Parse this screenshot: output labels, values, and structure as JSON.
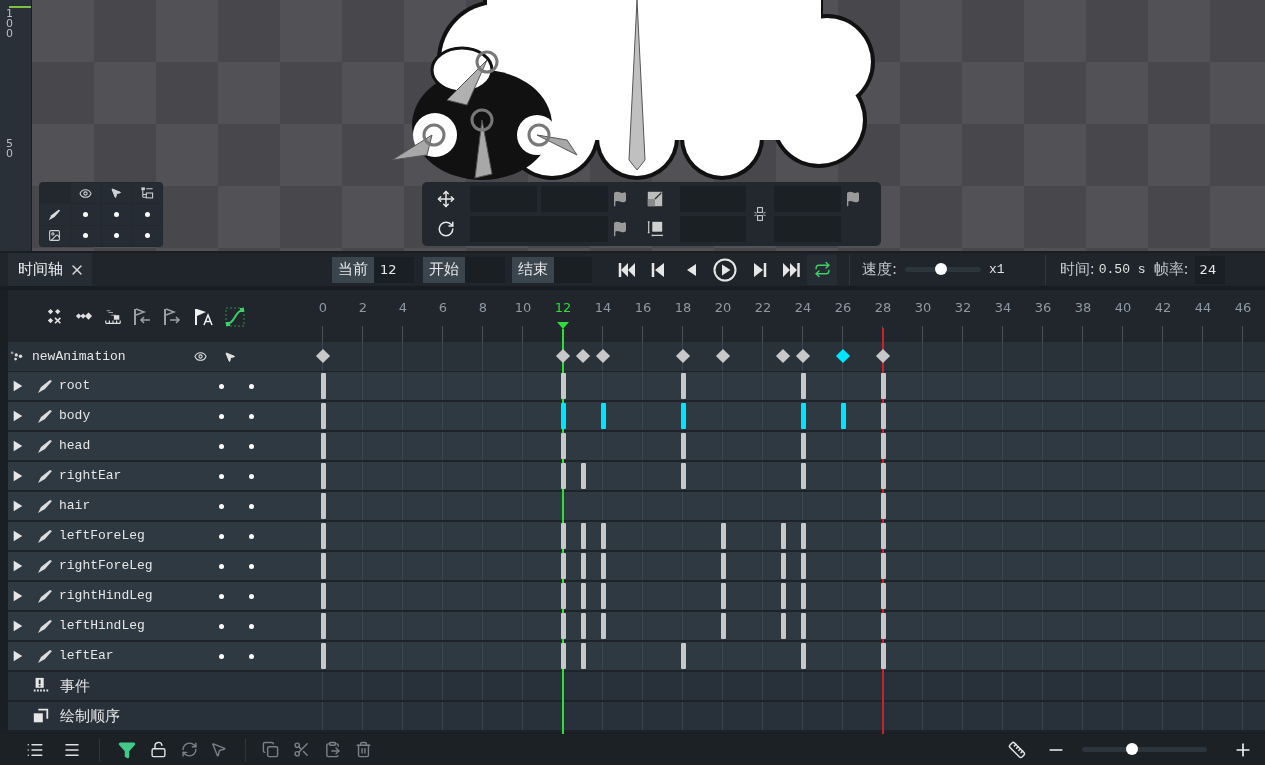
{
  "viewport": {
    "ruler_labels": [
      "100",
      "50"
    ]
  },
  "timeline": {
    "tab": {
      "label": "时间轴",
      "selected": true
    },
    "current": {
      "label": "当前",
      "value": "12"
    },
    "start": {
      "label": "开始"
    },
    "end": {
      "label": "结束"
    },
    "loop": {
      "on": true
    },
    "speed": {
      "label": "速度:",
      "level": 0.47,
      "reading": "x1"
    },
    "time": {
      "label": "时间:",
      "value": "0.50 s"
    },
    "fps": {
      "label": "帧率:",
      "value": "24"
    },
    "graph": {
      "on": true
    },
    "ticks": [
      {
        "label": "0",
        "kind": "normal"
      },
      {
        "label": "2",
        "kind": "normal"
      },
      {
        "label": "4",
        "kind": "normal"
      },
      {
        "label": "6",
        "kind": "normal"
      },
      {
        "label": "8",
        "kind": "normal"
      },
      {
        "label": "10",
        "kind": "normal"
      },
      {
        "label": "12",
        "kind": "current"
      },
      {
        "label": "14",
        "kind": "normal"
      },
      {
        "label": "16",
        "kind": "normal"
      },
      {
        "label": "18",
        "kind": "normal"
      },
      {
        "label": "20",
        "kind": "normal"
      },
      {
        "label": "22",
        "kind": "normal"
      },
      {
        "label": "24",
        "kind": "normal"
      },
      {
        "label": "26",
        "kind": "normal"
      },
      {
        "label": "28",
        "kind": "end"
      },
      {
        "label": "30",
        "kind": "normal"
      },
      {
        "label": "32",
        "kind": "normal"
      },
      {
        "label": "34",
        "kind": "normal"
      },
      {
        "label": "36",
        "kind": "normal"
      },
      {
        "label": "38",
        "kind": "normal"
      },
      {
        "label": "40",
        "kind": "normal"
      },
      {
        "label": "42",
        "kind": "normal"
      },
      {
        "label": "44",
        "kind": "normal"
      },
      {
        "label": "46",
        "kind": "normal"
      }
    ],
    "animation": {
      "name": "newAnimation",
      "frames": [
        {
          "key": true,
          "color": "#c8c8c8"
        },
        {
          "key": false
        },
        {
          "key": false
        },
        {
          "key": false
        },
        {
          "key": false
        },
        {
          "key": false
        },
        {
          "key": false
        },
        {
          "key": false
        },
        {
          "key": false
        },
        {
          "key": false
        },
        {
          "key": false
        },
        {
          "key": false
        },
        {
          "key": true,
          "color": "#c8c8c8"
        },
        {
          "key": true,
          "color": "#c8c8c8"
        },
        {
          "key": true,
          "color": "#c8c8c8"
        },
        {
          "key": false
        },
        {
          "key": false
        },
        {
          "key": false
        },
        {
          "key": true,
          "color": "#c8c8c8"
        },
        {
          "key": false
        },
        {
          "key": true,
          "color": "#c8c8c8"
        },
        {
          "key": false
        },
        {
          "key": false
        },
        {
          "key": true,
          "color": "#c8c8c8"
        },
        {
          "key": true,
          "color": "#c8c8c8"
        },
        {
          "key": false
        },
        {
          "key": true,
          "color": "#00e5ff"
        },
        {
          "key": false
        },
        {
          "key": true,
          "color": "#c8c8c8"
        }
      ]
    },
    "bones": [
      {
        "name": "root",
        "expanded": false,
        "frames": [
          {
            "key": true,
            "color": "#c8c8c8"
          },
          {
            "key": false
          },
          {
            "key": false
          },
          {
            "key": false
          },
          {
            "key": false
          },
          {
            "key": false
          },
          {
            "key": false
          },
          {
            "key": false
          },
          {
            "key": false
          },
          {
            "key": false
          },
          {
            "key": false
          },
          {
            "key": false
          },
          {
            "key": true,
            "color": "#c8c8c8"
          },
          {
            "key": false
          },
          {
            "key": false
          },
          {
            "key": false
          },
          {
            "key": false
          },
          {
            "key": false
          },
          {
            "key": true,
            "color": "#c8c8c8"
          },
          {
            "key": false
          },
          {
            "key": false
          },
          {
            "key": false
          },
          {
            "key": false
          },
          {
            "key": false
          },
          {
            "key": true,
            "color": "#c8c8c8"
          },
          {
            "key": false
          },
          {
            "key": false
          },
          {
            "key": false
          },
          {
            "key": true,
            "color": "#c8c8c8"
          }
        ]
      },
      {
        "name": "body",
        "expanded": false,
        "frames": [
          {
            "key": true,
            "color": "#c8c8c8"
          },
          {
            "key": false
          },
          {
            "key": false
          },
          {
            "key": false
          },
          {
            "key": false
          },
          {
            "key": false
          },
          {
            "key": false
          },
          {
            "key": false
          },
          {
            "key": false
          },
          {
            "key": false
          },
          {
            "key": false
          },
          {
            "key": false
          },
          {
            "key": true,
            "color": "#00e5ff"
          },
          {
            "key": false
          },
          {
            "key": true,
            "color": "#00e5ff"
          },
          {
            "key": false
          },
          {
            "key": false
          },
          {
            "key": false
          },
          {
            "key": true,
            "color": "#00e5ff"
          },
          {
            "key": false
          },
          {
            "key": false
          },
          {
            "key": false
          },
          {
            "key": false
          },
          {
            "key": false
          },
          {
            "key": true,
            "color": "#00e5ff"
          },
          {
            "key": false
          },
          {
            "key": true,
            "color": "#00e5ff"
          },
          {
            "key": false
          },
          {
            "key": true,
            "color": "#c8c8c8"
          }
        ]
      },
      {
        "name": "head",
        "expanded": false,
        "frames": [
          {
            "key": true,
            "color": "#c8c8c8"
          },
          {
            "key": false
          },
          {
            "key": false
          },
          {
            "key": false
          },
          {
            "key": false
          },
          {
            "key": false
          },
          {
            "key": false
          },
          {
            "key": false
          },
          {
            "key": false
          },
          {
            "key": false
          },
          {
            "key": false
          },
          {
            "key": false
          },
          {
            "key": true,
            "color": "#c8c8c8"
          },
          {
            "key": false
          },
          {
            "key": false
          },
          {
            "key": false
          },
          {
            "key": false
          },
          {
            "key": false
          },
          {
            "key": true,
            "color": "#c8c8c8"
          },
          {
            "key": false
          },
          {
            "key": false
          },
          {
            "key": false
          },
          {
            "key": false
          },
          {
            "key": false
          },
          {
            "key": true,
            "color": "#c8c8c8"
          },
          {
            "key": false
          },
          {
            "key": false
          },
          {
            "key": false
          },
          {
            "key": true,
            "color": "#c8c8c8"
          }
        ]
      },
      {
        "name": "rightEar",
        "expanded": false,
        "frames": [
          {
            "key": true,
            "color": "#c8c8c8"
          },
          {
            "key": false
          },
          {
            "key": false
          },
          {
            "key": false
          },
          {
            "key": false
          },
          {
            "key": false
          },
          {
            "key": false
          },
          {
            "key": false
          },
          {
            "key": false
          },
          {
            "key": false
          },
          {
            "key": false
          },
          {
            "key": false
          },
          {
            "key": true,
            "color": "#c8c8c8"
          },
          {
            "key": true,
            "color": "#c8c8c8"
          },
          {
            "key": false
          },
          {
            "key": false
          },
          {
            "key": false
          },
          {
            "key": false
          },
          {
            "key": true,
            "color": "#c8c8c8"
          },
          {
            "key": false
          },
          {
            "key": false
          },
          {
            "key": false
          },
          {
            "key": false
          },
          {
            "key": false
          },
          {
            "key": true,
            "color": "#c8c8c8"
          },
          {
            "key": false
          },
          {
            "key": false
          },
          {
            "key": false
          },
          {
            "key": true,
            "color": "#c8c8c8"
          }
        ]
      },
      {
        "name": "hair",
        "expanded": false,
        "frames": [
          {
            "key": true,
            "color": "#c8c8c8"
          },
          {
            "key": false
          },
          {
            "key": false
          },
          {
            "key": false
          },
          {
            "key": false
          },
          {
            "key": false
          },
          {
            "key": false
          },
          {
            "key": false
          },
          {
            "key": false
          },
          {
            "key": false
          },
          {
            "key": false
          },
          {
            "key": false
          },
          {
            "key": false
          },
          {
            "key": false
          },
          {
            "key": false
          },
          {
            "key": false
          },
          {
            "key": false
          },
          {
            "key": false
          },
          {
            "key": false
          },
          {
            "key": false
          },
          {
            "key": false
          },
          {
            "key": false
          },
          {
            "key": false
          },
          {
            "key": false
          },
          {
            "key": false
          },
          {
            "key": false
          },
          {
            "key": false
          },
          {
            "key": false
          },
          {
            "key": true,
            "color": "#c8c8c8"
          }
        ]
      },
      {
        "name": "leftForeLeg",
        "expanded": false,
        "frames": [
          {
            "key": true,
            "color": "#c8c8c8"
          },
          {
            "key": false
          },
          {
            "key": false
          },
          {
            "key": false
          },
          {
            "key": false
          },
          {
            "key": false
          },
          {
            "key": false
          },
          {
            "key": false
          },
          {
            "key": false
          },
          {
            "key": false
          },
          {
            "key": false
          },
          {
            "key": false
          },
          {
            "key": true,
            "color": "#c8c8c8"
          },
          {
            "key": true,
            "color": "#c8c8c8"
          },
          {
            "key": true,
            "color": "#c8c8c8"
          },
          {
            "key": false
          },
          {
            "key": false
          },
          {
            "key": false
          },
          {
            "key": false
          },
          {
            "key": false
          },
          {
            "key": true,
            "color": "#c8c8c8"
          },
          {
            "key": false
          },
          {
            "key": false
          },
          {
            "key": true,
            "color": "#c8c8c8"
          },
          {
            "key": true,
            "color": "#c8c8c8"
          },
          {
            "key": false
          },
          {
            "key": false
          },
          {
            "key": false
          },
          {
            "key": true,
            "color": "#c8c8c8"
          }
        ]
      },
      {
        "name": "rightForeLeg",
        "expanded": false,
        "frames": [
          {
            "key": true,
            "color": "#c8c8c8"
          },
          {
            "key": false
          },
          {
            "key": false
          },
          {
            "key": false
          },
          {
            "key": false
          },
          {
            "key": false
          },
          {
            "key": false
          },
          {
            "key": false
          },
          {
            "key": false
          },
          {
            "key": false
          },
          {
            "key": false
          },
          {
            "key": false
          },
          {
            "key": true,
            "color": "#c8c8c8"
          },
          {
            "key": true,
            "color": "#c8c8c8"
          },
          {
            "key": true,
            "color": "#c8c8c8"
          },
          {
            "key": false
          },
          {
            "key": false
          },
          {
            "key": false
          },
          {
            "key": false
          },
          {
            "key": false
          },
          {
            "key": true,
            "color": "#c8c8c8"
          },
          {
            "key": false
          },
          {
            "key": false
          },
          {
            "key": true,
            "color": "#c8c8c8"
          },
          {
            "key": true,
            "color": "#c8c8c8"
          },
          {
            "key": false
          },
          {
            "key": false
          },
          {
            "key": false
          },
          {
            "key": true,
            "color": "#c8c8c8"
          }
        ]
      },
      {
        "name": "rightHindLeg",
        "expanded": false,
        "frames": [
          {
            "key": true,
            "color": "#c8c8c8"
          },
          {
            "key": false
          },
          {
            "key": false
          },
          {
            "key": false
          },
          {
            "key": false
          },
          {
            "key": false
          },
          {
            "key": false
          },
          {
            "key": false
          },
          {
            "key": false
          },
          {
            "key": false
          },
          {
            "key": false
          },
          {
            "key": false
          },
          {
            "key": true,
            "color": "#c8c8c8"
          },
          {
            "key": true,
            "color": "#c8c8c8"
          },
          {
            "key": true,
            "color": "#c8c8c8"
          },
          {
            "key": false
          },
          {
            "key": false
          },
          {
            "key": false
          },
          {
            "key": false
          },
          {
            "key": false
          },
          {
            "key": true,
            "color": "#c8c8c8"
          },
          {
            "key": false
          },
          {
            "key": false
          },
          {
            "key": true,
            "color": "#c8c8c8"
          },
          {
            "key": true,
            "color": "#c8c8c8"
          },
          {
            "key": false
          },
          {
            "key": false
          },
          {
            "key": false
          },
          {
            "key": true,
            "color": "#c8c8c8"
          }
        ]
      },
      {
        "name": "leftHindLeg",
        "expanded": false,
        "frames": [
          {
            "key": true,
            "color": "#c8c8c8"
          },
          {
            "key": false
          },
          {
            "key": false
          },
          {
            "key": false
          },
          {
            "key": false
          },
          {
            "key": false
          },
          {
            "key": false
          },
          {
            "key": false
          },
          {
            "key": false
          },
          {
            "key": false
          },
          {
            "key": false
          },
          {
            "key": false
          },
          {
            "key": true,
            "color": "#c8c8c8"
          },
          {
            "key": true,
            "color": "#c8c8c8"
          },
          {
            "key": true,
            "color": "#c8c8c8"
          },
          {
            "key": false
          },
          {
            "key": false
          },
          {
            "key": false
          },
          {
            "key": false
          },
          {
            "key": false
          },
          {
            "key": true,
            "color": "#c8c8c8"
          },
          {
            "key": false
          },
          {
            "key": false
          },
          {
            "key": true,
            "color": "#c8c8c8"
          },
          {
            "key": true,
            "color": "#c8c8c8"
          },
          {
            "key": false
          },
          {
            "key": false
          },
          {
            "key": false
          },
          {
            "key": true,
            "color": "#c8c8c8"
          }
        ]
      },
      {
        "name": "leftEar",
        "expanded": false,
        "frames": [
          {
            "key": true,
            "color": "#c8c8c8"
          },
          {
            "key": false
          },
          {
            "key": false
          },
          {
            "key": false
          },
          {
            "key": false
          },
          {
            "key": false
          },
          {
            "key": false
          },
          {
            "key": false
          },
          {
            "key": false
          },
          {
            "key": false
          },
          {
            "key": false
          },
          {
            "key": false
          },
          {
            "key": true,
            "color": "#c8c8c8"
          },
          {
            "key": true,
            "color": "#c8c8c8"
          },
          {
            "key": false
          },
          {
            "key": false
          },
          {
            "key": false
          },
          {
            "key": false
          },
          {
            "key": true,
            "color": "#c8c8c8"
          },
          {
            "key": false
          },
          {
            "key": false
          },
          {
            "key": false
          },
          {
            "key": false
          },
          {
            "key": false
          },
          {
            "key": true,
            "color": "#c8c8c8"
          },
          {
            "key": false
          },
          {
            "key": false
          },
          {
            "key": false
          },
          {
            "key": true,
            "color": "#c8c8c8"
          }
        ]
      }
    ],
    "extra_rows": [
      {
        "kind": "events",
        "label": "事件"
      },
      {
        "kind": "draw_order",
        "label": "绘制顺序"
      }
    ]
  },
  "bottom_bar": {
    "filter": {
      "on": true
    },
    "zoom": {
      "level": 0.4
    }
  }
}
